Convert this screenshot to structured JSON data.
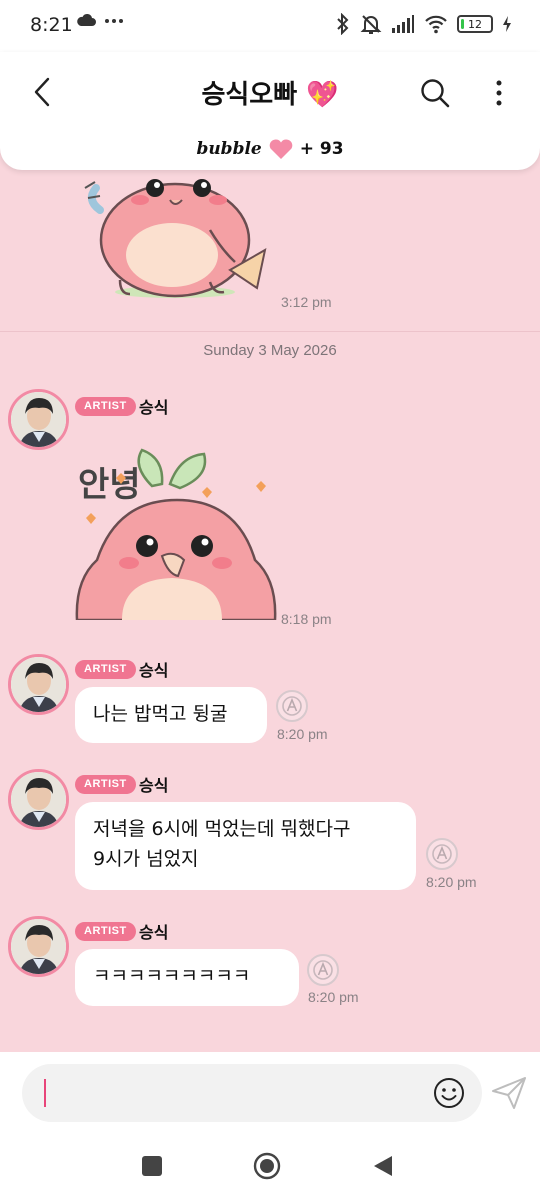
{
  "status_bar": {
    "time": "8:21",
    "battery": "12",
    "battery_fraction": 0.12
  },
  "header": {
    "title": "승식오빠 💖",
    "bubble_brand": "bubble",
    "bubble_extra": "+ 93"
  },
  "chat": {
    "sticker_1_time": "3:12 pm",
    "date_separator": "Sunday 3 May 2026",
    "sticker_2_time": "8:18 pm",
    "sticker_2_text": "안녕",
    "messages": [
      {
        "badge": "ARTIST",
        "sender": "승식"
      },
      {
        "badge": "ARTIST",
        "sender": "승식",
        "text": "나는 밥먹고 뒹굴",
        "time": "8:20 pm"
      },
      {
        "badge": "ARTIST",
        "sender": "승식",
        "text_line1": "저녁을 6시에 먹었는데 뭐했다구",
        "text_line2": "9시가 넘었지",
        "time": "8:20 pm"
      },
      {
        "badge": "ARTIST",
        "sender": "승식",
        "text": "ㅋㅋㅋㅋㅋㅋㅋㅋㅋ",
        "time": "8:20 pm"
      }
    ]
  },
  "input": {
    "placeholder": ""
  },
  "colors": {
    "background": "#f9d6dc",
    "accent": "#f07591",
    "heart": "#f48aa6"
  }
}
